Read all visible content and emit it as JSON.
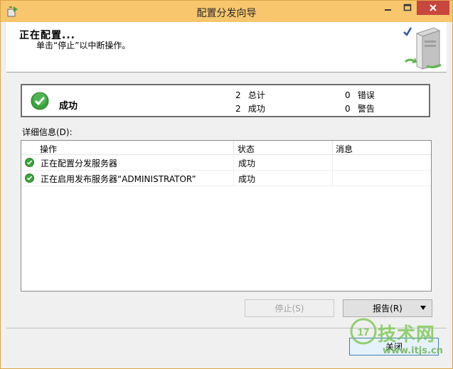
{
  "window": {
    "title": "配置分发向导"
  },
  "header": {
    "title": "正在配置...",
    "subtitle": "单击“停止”以中断操作。"
  },
  "status": {
    "label": "成功",
    "total_count": "2",
    "total_label": "总计",
    "success_count": "2",
    "success_label": "成功",
    "error_count": "0",
    "error_label": "错误",
    "warning_count": "0",
    "warning_label": "警告"
  },
  "details": {
    "label": "详细信息(D):",
    "columns": [
      "操作",
      "状态",
      "消息"
    ],
    "rows": [
      {
        "icon": "success-icon",
        "action": "正在配置分发服务器",
        "status": "成功",
        "message": ""
      },
      {
        "icon": "success-icon",
        "action": "正在启用发布服务器“ADMINISTRATOR”",
        "status": "成功",
        "message": ""
      }
    ]
  },
  "buttons": {
    "stop": "停止(S)",
    "report": "报告(R)",
    "close": "关闭"
  },
  "watermark": {
    "logo": "17",
    "text": "技术网",
    "url": "www.itjs.cn"
  },
  "colors": {
    "titlebar": "#f7c66d",
    "close_button": "#c7463e",
    "success_green": "#3aa33a"
  }
}
